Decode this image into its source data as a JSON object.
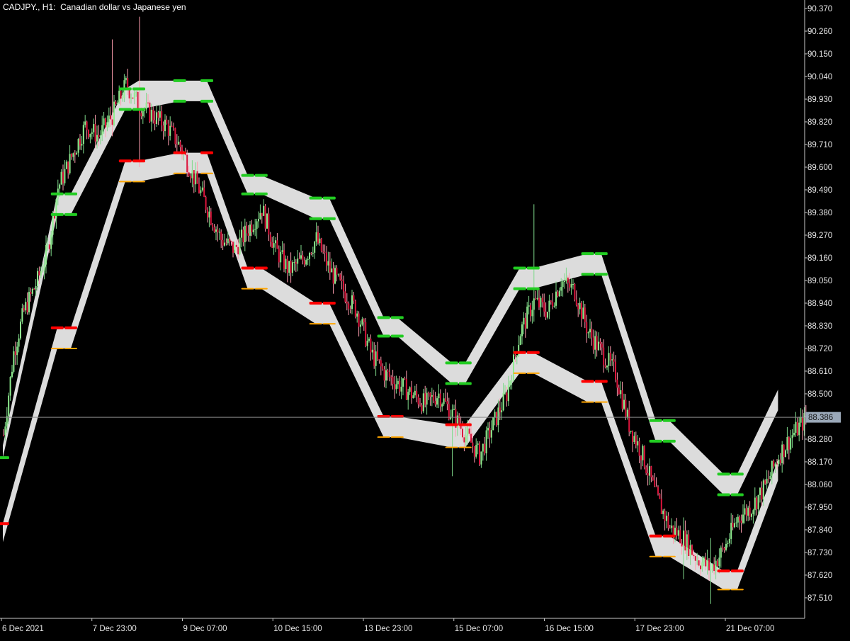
{
  "window": {
    "symbol": "CADJPY.",
    "timeframe": "H1",
    "description": "Canadian dollar vs Japanese yen",
    "title_text": "CADJPY., H1:  Canadian dollar vs Japanese yen"
  },
  "colors": {
    "background": "#000000",
    "axis": "#c8c8c8",
    "candle_bull": "#90ee90",
    "candle_bear": "#dc143c",
    "candle_bull_wick": "#7fd88a",
    "candle_bear_wick": "#ff9eb0",
    "band_fill": "#dcdcdc",
    "marker_green": "#22cc22",
    "marker_red": "#ff0000",
    "marker_orange": "#ffa500",
    "price_tag": "#9aa8b8",
    "price_line": "#8c8c8c"
  },
  "chart_data": {
    "type": "candlestick",
    "title": "CADJPY., H1:  Canadian dollar vs Japanese yen",
    "y_axis": {
      "position": "right",
      "ticks": [
        "90.370",
        "90.260",
        "90.150",
        "90.040",
        "89.930",
        "89.820",
        "89.710",
        "89.600",
        "89.490",
        "89.380",
        "89.270",
        "89.160",
        "89.050",
        "88.940",
        "88.830",
        "88.720",
        "88.610",
        "88.500",
        "88.390",
        "88.280",
        "88.170",
        "88.060",
        "87.950",
        "87.840",
        "87.730",
        "87.620",
        "87.510"
      ],
      "range": [
        87.36,
        90.39
      ]
    },
    "x_axis": {
      "ticks": [
        "6 Dec 2021",
        "7 Dec 23:00",
        "9 Dec 07:00",
        "10 Dec 15:00",
        "13 Dec 23:00",
        "15 Dec 07:00",
        "16 Dec 15:00",
        "17 Dec 23:00",
        "21 Dec 07:00"
      ]
    },
    "current_price": "88.386",
    "price_path": [
      [
        0,
        88.3
      ],
      [
        6,
        88.7
      ],
      [
        12,
        88.9
      ],
      [
        20,
        89.05
      ],
      [
        26,
        89.2
      ],
      [
        32,
        89.5
      ],
      [
        40,
        89.65
      ],
      [
        48,
        89.8
      ],
      [
        56,
        89.75
      ],
      [
        64,
        89.85
      ],
      [
        72,
        90.0
      ],
      [
        80,
        89.9
      ],
      [
        88,
        89.85
      ],
      [
        96,
        89.8
      ],
      [
        104,
        89.7
      ],
      [
        112,
        89.55
      ],
      [
        120,
        89.4
      ],
      [
        128,
        89.25
      ],
      [
        136,
        89.2
      ],
      [
        144,
        89.3
      ],
      [
        152,
        89.4
      ],
      [
        160,
        89.2
      ],
      [
        168,
        89.1
      ],
      [
        176,
        89.15
      ],
      [
        184,
        89.25
      ],
      [
        192,
        89.1
      ],
      [
        200,
        89.0
      ],
      [
        208,
        88.9
      ],
      [
        216,
        88.7
      ],
      [
        224,
        88.6
      ],
      [
        232,
        88.55
      ],
      [
        240,
        88.5
      ],
      [
        248,
        88.45
      ],
      [
        256,
        88.5
      ],
      [
        264,
        88.4
      ],
      [
        272,
        88.3
      ],
      [
        280,
        88.2
      ],
      [
        288,
        88.35
      ],
      [
        296,
        88.5
      ],
      [
        304,
        88.8
      ],
      [
        312,
        88.95
      ],
      [
        320,
        88.9
      ],
      [
        328,
        89.05
      ],
      [
        336,
        89.0
      ],
      [
        344,
        88.8
      ],
      [
        352,
        88.7
      ],
      [
        360,
        88.6
      ],
      [
        368,
        88.35
      ],
      [
        376,
        88.2
      ],
      [
        384,
        88.0
      ],
      [
        392,
        87.85
      ],
      [
        400,
        87.8
      ],
      [
        408,
        87.7
      ],
      [
        416,
        87.65
      ],
      [
        424,
        87.75
      ],
      [
        432,
        87.9
      ],
      [
        440,
        87.95
      ],
      [
        448,
        88.05
      ],
      [
        456,
        88.2
      ],
      [
        464,
        88.3
      ],
      [
        472,
        88.38
      ]
    ],
    "spikes": [
      {
        "bar": 80,
        "high": 90.33,
        "low": 89.6
      },
      {
        "bar": 64,
        "high": 90.22,
        "low": 89.75
      },
      {
        "bar": 312,
        "high": 89.42,
        "low": 88.85
      },
      {
        "bar": 416,
        "high": 87.8,
        "low": 87.48
      },
      {
        "bar": 400,
        "high": 87.9,
        "low": 87.6
      },
      {
        "bar": 264,
        "high": 88.35,
        "low": 88.1
      }
    ],
    "band_top": [
      [
        0,
        88.25,
        88.19
      ],
      [
        32,
        89.47,
        89.37
      ],
      [
        40,
        89.47,
        89.37
      ],
      [
        72,
        89.98,
        89.88
      ],
      [
        80,
        90.02,
        89.88
      ],
      [
        104,
        90.02,
        89.92
      ],
      [
        120,
        90.02,
        89.92
      ],
      [
        144,
        89.56,
        89.47
      ],
      [
        152,
        89.56,
        89.47
      ],
      [
        184,
        89.45,
        89.35
      ],
      [
        192,
        89.45,
        89.35
      ],
      [
        224,
        88.87,
        88.78
      ],
      [
        232,
        88.87,
        88.78
      ],
      [
        264,
        88.65,
        88.55
      ],
      [
        272,
        88.65,
        88.55
      ],
      [
        304,
        89.11,
        89.01
      ],
      [
        312,
        89.11,
        89.01
      ],
      [
        344,
        89.18,
        89.08
      ],
      [
        352,
        89.18,
        89.08
      ],
      [
        384,
        88.37,
        88.27
      ],
      [
        392,
        88.37,
        88.27
      ],
      [
        424,
        88.11,
        88.01
      ],
      [
        432,
        88.11,
        88.01
      ],
      [
        456,
        88.52,
        88.42
      ]
    ],
    "band_bottom": [
      [
        0,
        87.87,
        87.78
      ],
      [
        32,
        88.82,
        88.72
      ],
      [
        40,
        88.82,
        88.72
      ],
      [
        72,
        89.63,
        89.53
      ],
      [
        80,
        89.63,
        89.53
      ],
      [
        104,
        89.67,
        89.57
      ],
      [
        120,
        89.67,
        89.57
      ],
      [
        144,
        89.11,
        89.01
      ],
      [
        152,
        89.11,
        89.01
      ],
      [
        184,
        88.94,
        88.84
      ],
      [
        192,
        88.94,
        88.84
      ],
      [
        224,
        88.39,
        88.29
      ],
      [
        232,
        88.39,
        88.29
      ],
      [
        264,
        88.35,
        88.24
      ],
      [
        272,
        88.35,
        88.24
      ],
      [
        304,
        88.7,
        88.6
      ],
      [
        312,
        88.7,
        88.6
      ],
      [
        344,
        88.56,
        88.46
      ],
      [
        352,
        88.56,
        88.46
      ],
      [
        384,
        87.81,
        87.71
      ],
      [
        392,
        87.81,
        87.71
      ],
      [
        424,
        87.64,
        87.55
      ],
      [
        432,
        87.64,
        87.55
      ],
      [
        456,
        88.18,
        88.08
      ]
    ],
    "markers": [
      {
        "bar": 0,
        "price": 88.19,
        "color": "green"
      },
      {
        "bar": 32,
        "price": 89.47,
        "color": "green"
      },
      {
        "bar": 40,
        "price": 89.47,
        "color": "green"
      },
      {
        "bar": 32,
        "price": 89.37,
        "color": "green"
      },
      {
        "bar": 40,
        "price": 89.37,
        "color": "green"
      },
      {
        "bar": 72,
        "price": 89.98,
        "color": "green"
      },
      {
        "bar": 80,
        "price": 89.98,
        "color": "green"
      },
      {
        "bar": 72,
        "price": 89.88,
        "color": "green"
      },
      {
        "bar": 80,
        "price": 89.88,
        "color": "green"
      },
      {
        "bar": 104,
        "price": 90.02,
        "color": "green"
      },
      {
        "bar": 120,
        "price": 90.02,
        "color": "green"
      },
      {
        "bar": 104,
        "price": 89.92,
        "color": "green"
      },
      {
        "bar": 120,
        "price": 89.92,
        "color": "green"
      },
      {
        "bar": 144,
        "price": 89.56,
        "color": "green"
      },
      {
        "bar": 152,
        "price": 89.56,
        "color": "green"
      },
      {
        "bar": 144,
        "price": 89.47,
        "color": "green"
      },
      {
        "bar": 152,
        "price": 89.47,
        "color": "green"
      },
      {
        "bar": 184,
        "price": 89.45,
        "color": "green"
      },
      {
        "bar": 192,
        "price": 89.45,
        "color": "green"
      },
      {
        "bar": 184,
        "price": 89.35,
        "color": "green"
      },
      {
        "bar": 192,
        "price": 89.35,
        "color": "green"
      },
      {
        "bar": 224,
        "price": 88.87,
        "color": "green"
      },
      {
        "bar": 232,
        "price": 88.87,
        "color": "green"
      },
      {
        "bar": 224,
        "price": 88.78,
        "color": "green"
      },
      {
        "bar": 232,
        "price": 88.78,
        "color": "green"
      },
      {
        "bar": 264,
        "price": 88.65,
        "color": "green"
      },
      {
        "bar": 272,
        "price": 88.65,
        "color": "green"
      },
      {
        "bar": 264,
        "price": 88.55,
        "color": "green"
      },
      {
        "bar": 272,
        "price": 88.55,
        "color": "green"
      },
      {
        "bar": 304,
        "price": 89.11,
        "color": "green"
      },
      {
        "bar": 312,
        "price": 89.11,
        "color": "green"
      },
      {
        "bar": 304,
        "price": 89.01,
        "color": "green"
      },
      {
        "bar": 312,
        "price": 89.01,
        "color": "green"
      },
      {
        "bar": 344,
        "price": 89.18,
        "color": "green"
      },
      {
        "bar": 352,
        "price": 89.18,
        "color": "green"
      },
      {
        "bar": 344,
        "price": 89.08,
        "color": "green"
      },
      {
        "bar": 352,
        "price": 89.08,
        "color": "green"
      },
      {
        "bar": 384,
        "price": 88.37,
        "color": "green"
      },
      {
        "bar": 392,
        "price": 88.37,
        "color": "green"
      },
      {
        "bar": 384,
        "price": 88.27,
        "color": "green"
      },
      {
        "bar": 392,
        "price": 88.27,
        "color": "green"
      },
      {
        "bar": 424,
        "price": 88.11,
        "color": "green"
      },
      {
        "bar": 432,
        "price": 88.11,
        "color": "green"
      },
      {
        "bar": 424,
        "price": 88.01,
        "color": "green"
      },
      {
        "bar": 432,
        "price": 88.01,
        "color": "green"
      },
      {
        "bar": 0,
        "price": 87.87,
        "color": "red"
      },
      {
        "bar": 32,
        "price": 88.82,
        "color": "red"
      },
      {
        "bar": 40,
        "price": 88.82,
        "color": "red"
      },
      {
        "bar": 72,
        "price": 89.63,
        "color": "red"
      },
      {
        "bar": 80,
        "price": 89.63,
        "color": "red"
      },
      {
        "bar": 104,
        "price": 89.67,
        "color": "red"
      },
      {
        "bar": 120,
        "price": 89.67,
        "color": "red"
      },
      {
        "bar": 144,
        "price": 89.11,
        "color": "red"
      },
      {
        "bar": 152,
        "price": 89.11,
        "color": "red"
      },
      {
        "bar": 184,
        "price": 88.94,
        "color": "red"
      },
      {
        "bar": 192,
        "price": 88.94,
        "color": "red"
      },
      {
        "bar": 224,
        "price": 88.39,
        "color": "red"
      },
      {
        "bar": 232,
        "price": 88.39,
        "color": "red"
      },
      {
        "bar": 264,
        "price": 88.35,
        "color": "red"
      },
      {
        "bar": 272,
        "price": 88.35,
        "color": "red"
      },
      {
        "bar": 304,
        "price": 88.7,
        "color": "red"
      },
      {
        "bar": 312,
        "price": 88.7,
        "color": "red"
      },
      {
        "bar": 344,
        "price": 88.56,
        "color": "red"
      },
      {
        "bar": 352,
        "price": 88.56,
        "color": "red"
      },
      {
        "bar": 384,
        "price": 87.81,
        "color": "red"
      },
      {
        "bar": 392,
        "price": 87.81,
        "color": "red"
      },
      {
        "bar": 424,
        "price": 87.64,
        "color": "red"
      },
      {
        "bar": 432,
        "price": 87.64,
        "color": "red"
      },
      {
        "bar": 32,
        "price": 88.72,
        "color": "orange"
      },
      {
        "bar": 40,
        "price": 88.72,
        "color": "orange"
      },
      {
        "bar": 72,
        "price": 89.53,
        "color": "orange"
      },
      {
        "bar": 80,
        "price": 89.53,
        "color": "orange"
      },
      {
        "bar": 104,
        "price": 89.57,
        "color": "orange"
      },
      {
        "bar": 120,
        "price": 89.57,
        "color": "orange"
      },
      {
        "bar": 144,
        "price": 89.01,
        "color": "orange"
      },
      {
        "bar": 152,
        "price": 89.01,
        "color": "orange"
      },
      {
        "bar": 184,
        "price": 88.84,
        "color": "orange"
      },
      {
        "bar": 192,
        "price": 88.84,
        "color": "orange"
      },
      {
        "bar": 224,
        "price": 88.29,
        "color": "orange"
      },
      {
        "bar": 232,
        "price": 88.29,
        "color": "orange"
      },
      {
        "bar": 264,
        "price": 88.24,
        "color": "orange"
      },
      {
        "bar": 272,
        "price": 88.24,
        "color": "orange"
      },
      {
        "bar": 304,
        "price": 88.6,
        "color": "orange"
      },
      {
        "bar": 312,
        "price": 88.6,
        "color": "orange"
      },
      {
        "bar": 344,
        "price": 88.46,
        "color": "orange"
      },
      {
        "bar": 352,
        "price": 88.46,
        "color": "orange"
      },
      {
        "bar": 384,
        "price": 87.71,
        "color": "orange"
      },
      {
        "bar": 392,
        "price": 87.71,
        "color": "orange"
      },
      {
        "bar": 424,
        "price": 87.55,
        "color": "orange"
      },
      {
        "bar": 432,
        "price": 87.55,
        "color": "orange"
      }
    ]
  }
}
